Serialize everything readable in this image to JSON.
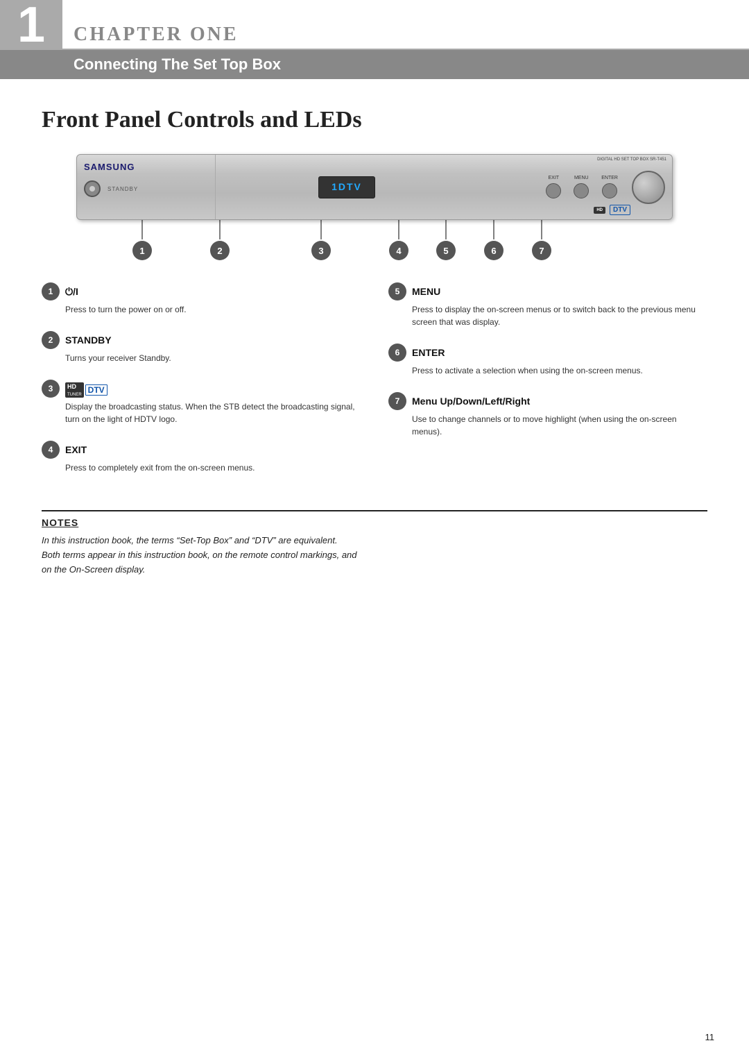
{
  "chapter": {
    "number": "1",
    "label": "CHAPTER ONE",
    "subtitle": "Connecting The Set Top Box"
  },
  "section": {
    "title": "Front Panel Controls and LEDs"
  },
  "device": {
    "brand": "SAMSUNG",
    "model": "DIGITAL HD SET TOP BOX  SR-T451",
    "display_text": "1DTV",
    "standby_text": "STANDBY"
  },
  "callouts": [
    {
      "id": "1",
      "left_pct": 11
    },
    {
      "id": "2",
      "left_pct": 24
    },
    {
      "id": "3",
      "left_pct": 41
    },
    {
      "id": "4",
      "left_pct": 54
    },
    {
      "id": "5",
      "left_pct": 62
    },
    {
      "id": "6",
      "left_pct": 70
    },
    {
      "id": "7",
      "left_pct": 78
    }
  ],
  "controls": [
    {
      "num": "1",
      "title": "⏻/I",
      "body": "Press to turn the power on or off."
    },
    {
      "num": "2",
      "title": "STANDBY",
      "body": "Turns your receiver Standby."
    },
    {
      "num": "3",
      "title": "HDTV",
      "is_hdtv": true,
      "body": "Display the broadcasting status. When the STB detect the broadcasting signal, turn on the light of HDTV logo."
    },
    {
      "num": "4",
      "title": "EXIT",
      "body": "Press to completely exit from the on-screen menus."
    },
    {
      "num": "5",
      "title": "MENU",
      "body": "Press to display the on-screen menus or to switch back to the previous menu screen that was display."
    },
    {
      "num": "6",
      "title": "ENTER",
      "body": "Press to activate a selection when using the on-screen menus."
    },
    {
      "num": "7",
      "title": "Menu Up/Down/Left/Right",
      "body": "Use to change channels or to move highlight (when using the on-screen menus)."
    }
  ],
  "notes": {
    "title": "NOTES",
    "body": "In this instruction book, the terms “Set-Top Box” and “DTV” are equivalent.\nBoth terms appear in this instruction book, on the remote control markings, and\non the On-Screen display."
  },
  "page_number": "11"
}
